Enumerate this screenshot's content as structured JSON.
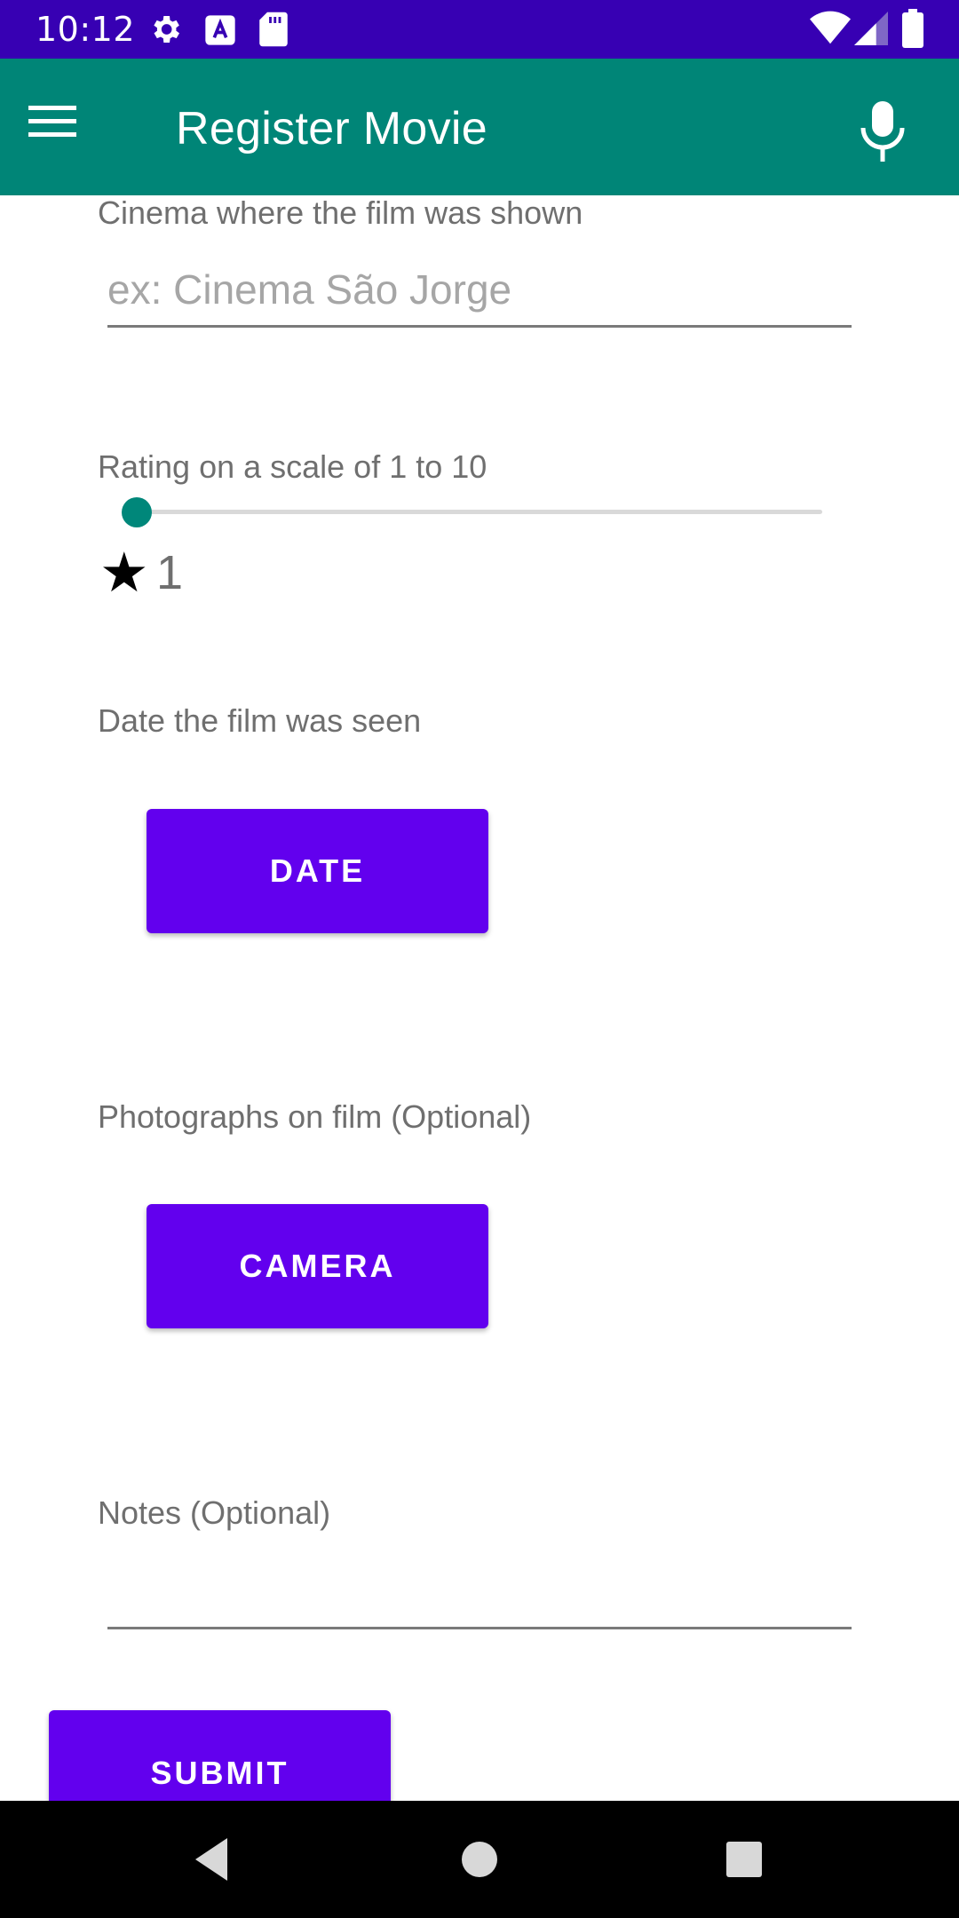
{
  "status_bar": {
    "time": "10:12",
    "icons": [
      "settings-icon",
      "text-a-icon",
      "sd-card-icon",
      "wifi-icon",
      "signal-icon",
      "battery-icon"
    ],
    "background": "#3700b3"
  },
  "app_bar": {
    "title": "Register Movie",
    "menu_icon": "hamburger-menu-icon",
    "mic_icon": "microphone-icon",
    "background": "#008577"
  },
  "form": {
    "cinema": {
      "label": "Cinema where the film was shown",
      "placeholder": "ex: Cinema São Jorge",
      "value": ""
    },
    "rating": {
      "label": "Rating on a scale of 1 to 10",
      "value": "1",
      "min": 1,
      "max": 10,
      "star_icon": "star-icon",
      "star_glyph": "★",
      "accent": "#00877a"
    },
    "date": {
      "label": "Date the film was seen",
      "button_label": "DATE"
    },
    "photos": {
      "label": "Photographs on film (Optional)",
      "button_label": "CAMERA"
    },
    "notes": {
      "label": "Notes (Optional)",
      "value": ""
    },
    "submit_label": "SUBMIT",
    "button_color": "#6200ee"
  },
  "nav_bar": {
    "items": [
      "back-icon",
      "home-icon",
      "recents-icon"
    ]
  }
}
